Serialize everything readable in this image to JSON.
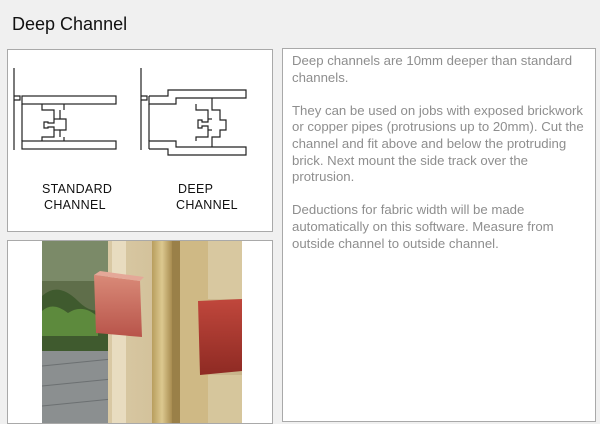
{
  "page": {
    "title": "Deep Channel"
  },
  "diagram": {
    "standard": {
      "line1": "STANDARD",
      "line2": "CHANNEL"
    },
    "deep": {
      "line1": "DEEP",
      "line2": "CHANNEL"
    }
  },
  "description": {
    "paragraphs": [
      "Deep channels are 10mm deeper than standard channels.",
      "They can be used on jobs with exposed brickwork or copper pipes (protrusions up to 20mm).  Cut the channel and fit above and below the protruding brick.  Next mount the side track over the protrusion.",
      "Deductions for fabric width will be made automatically on this software.  Measure from outside channel to outside channel."
    ]
  }
}
